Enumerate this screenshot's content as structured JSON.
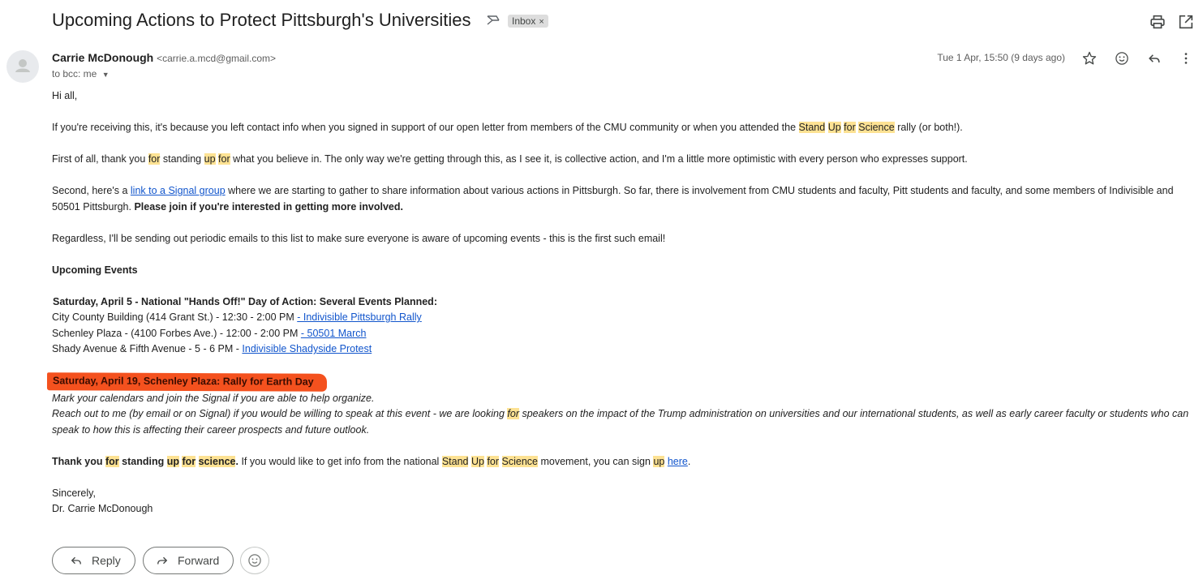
{
  "email": {
    "subject": "Upcoming Actions to Protect Pittsburgh's Universities",
    "label": "Inbox",
    "label_remove": "×",
    "sender_name": "Carrie McDonough",
    "sender_email": "<carrie.a.mcd@gmail.com>",
    "recipients": "to bcc: me",
    "date": "Tue 1 Apr, 15:50 (9 days ago)"
  },
  "body": {
    "greeting": "Hi all,",
    "p1_a": "If you're receiving this, it's because you left contact info when you signed in support of our open letter from members of the CMU community or when you attended the ",
    "p1_hl1": "Stand",
    "p1_hl2": "Up",
    "p1_hl3": "for",
    "p1_hl4": "Science",
    "p1_b": " rally (or both!).",
    "p2_a": "First of all, thank you ",
    "p2_hl1": "for",
    "p2_b": " standing ",
    "p2_hl2": "up",
    "p2_hl3": "for",
    "p2_c": " what you believe in. The only way we're getting through this, as I see it, is collective action, and I'm a little more optimistic with every person who expresses support.",
    "p3_a": "Second, here's a ",
    "p3_link": "link to a Signal group",
    "p3_b": " where we are starting to gather to share information about various actions in Pittsburgh. So far, there is involvement from CMU students and faculty, Pitt students and faculty, and some members of Indivisible and 50501 Pittsburgh. ",
    "p3_bold": "Please join if you're interested in getting more involved.",
    "p4": "Regardless, I'll be sending out periodic emails to this list to make sure everyone is aware of upcoming events - this is the first such email!",
    "upcoming_heading": "Upcoming Events",
    "event1_title": "Saturday, April 5 - National \"Hands Off!\" Day of Action: Several Events Planned:",
    "event1_l1_text": "City County Building (414 Grant St.) - 12:30 - 2:00 PM ",
    "event1_l1_link": "- Indivisible Pittsburgh Rally",
    "event1_l2_text": "Schenley Plaza - (4100 Forbes Ave.) - 12:00 - 2:00 PM ",
    "event1_l2_link": "- 50501 March ",
    "event1_l3_text": "Shady Avenue & Fifth Avenue - 5 - 6 PM - ",
    "event1_l3_link": "Indivisible Shadyside Protest",
    "event2_title": "Saturday, April 19, Schenley Plaza: Rally for Earth Day",
    "event2_l1": "Mark your calendars and join the Signal if you are able to help organize.",
    "event2_l2_a": "Reach out to me (by email or on Signal) if you would be willing to speak at this event - we are looking ",
    "event2_l2_hl": "for",
    "event2_l2_b": " speakers on the impact of the Trump administration on universities and our international students, as well as early career faculty or students who can speak to how this is affecting their career prospects and future outlook.",
    "thanks_b1": "Thank you ",
    "thanks_hl1": "for",
    "thanks_b2": " standing ",
    "thanks_hl2": "up",
    "thanks_hl3": "for",
    "thanks_hl4": "science",
    "thanks_b3": ".",
    "thanks_t1": " If you would like to get info from the national ",
    "thanks_hl5": "Stand",
    "thanks_hl6": "Up",
    "thanks_hl7": "for",
    "thanks_hl8": "Science",
    "thanks_t2": " movement, you can sign ",
    "thanks_hl9": "up",
    "thanks_link": "here",
    "thanks_t3": ".",
    "closing": "Sincerely,",
    "signature": "Dr. Carrie McDonough"
  },
  "actions": {
    "reply": "Reply",
    "forward": "Forward"
  },
  "colors": {
    "highlight": "#fde293",
    "annotation": "#f4511e",
    "link": "#1155cc"
  },
  "icons": [
    "print-icon",
    "open-new-window-icon",
    "star-icon",
    "emoji-icon",
    "reply-icon",
    "more-vert-icon",
    "label-important-icon",
    "avatar-icon"
  ]
}
